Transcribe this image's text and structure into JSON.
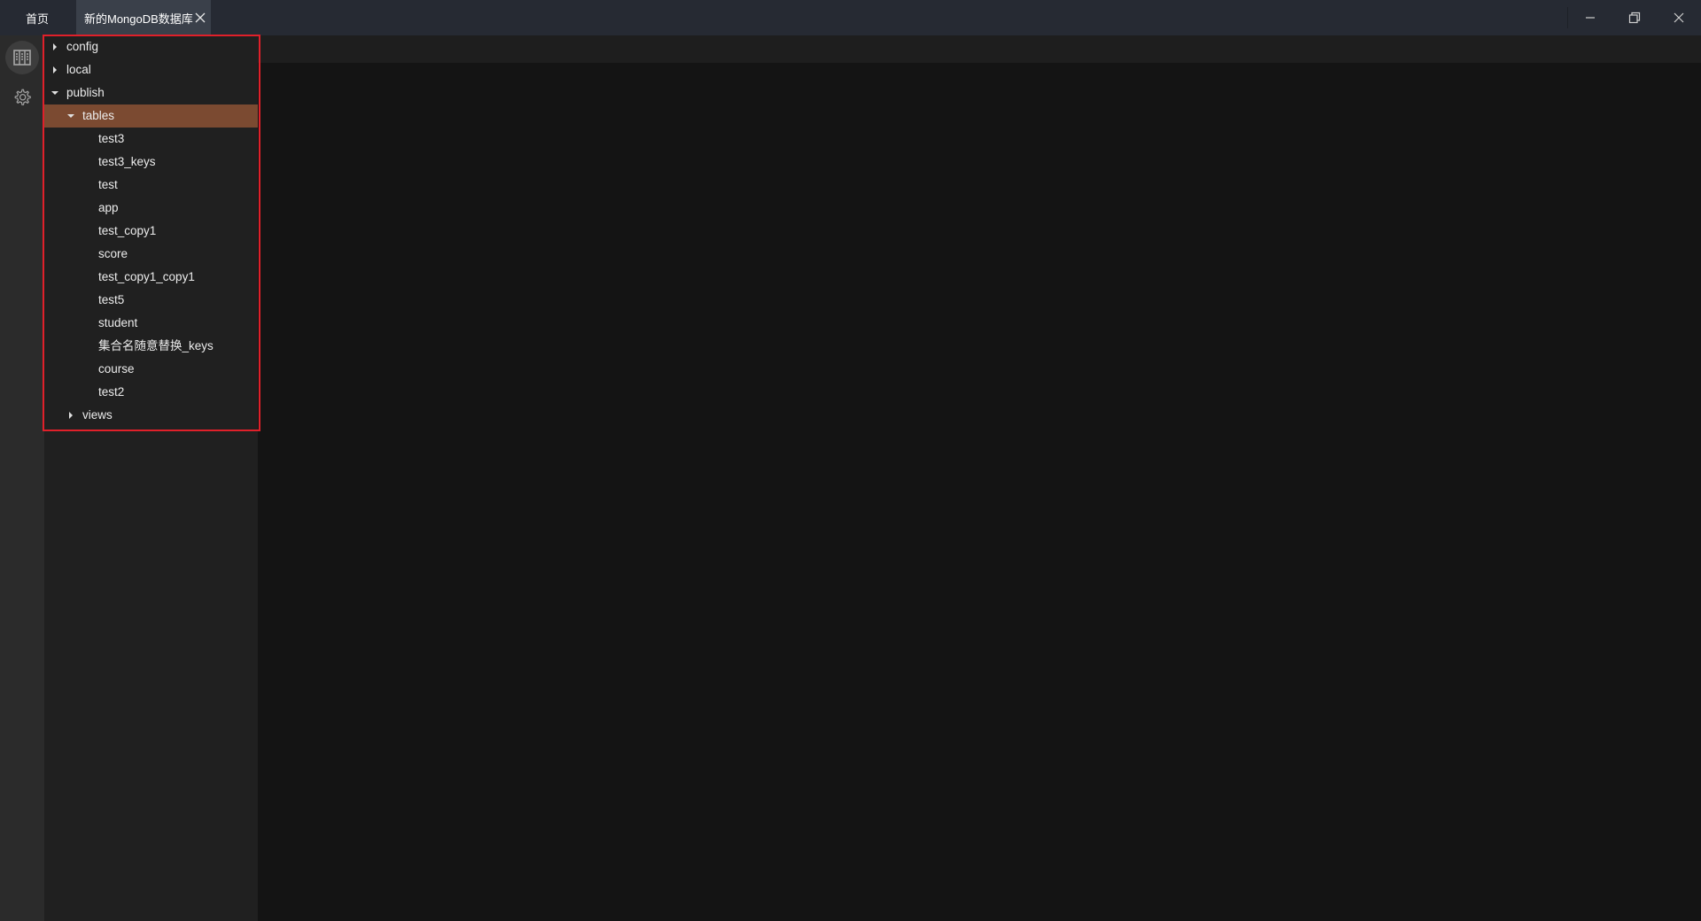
{
  "titlebar": {
    "tabs": [
      {
        "label": "首页"
      },
      {
        "label": "新的MongoDB数据库"
      }
    ]
  },
  "activity_bar": {
    "items": [
      {
        "icon": "database-icon",
        "active": true
      },
      {
        "icon": "gear-icon",
        "active": false
      }
    ]
  },
  "sidebar": {
    "tree": {
      "config": "config",
      "local": "local",
      "publish": "publish",
      "tables": "tables",
      "tables_items": [
        "test3",
        "test3_keys",
        "test",
        "app",
        "test_copy1",
        "score",
        "test_copy1_copy1",
        "test5",
        "student",
        "集合名随意替换_keys",
        "course",
        "test2"
      ],
      "views": "views"
    }
  },
  "colors": {
    "titlebar_bg": "#262a33",
    "active_tab_bg": "#3a404a",
    "selected_node_bg": "#7b4a31",
    "highlight_border": "#e0202a",
    "main_bg": "#141414",
    "sidebar_bg": "#202020"
  }
}
